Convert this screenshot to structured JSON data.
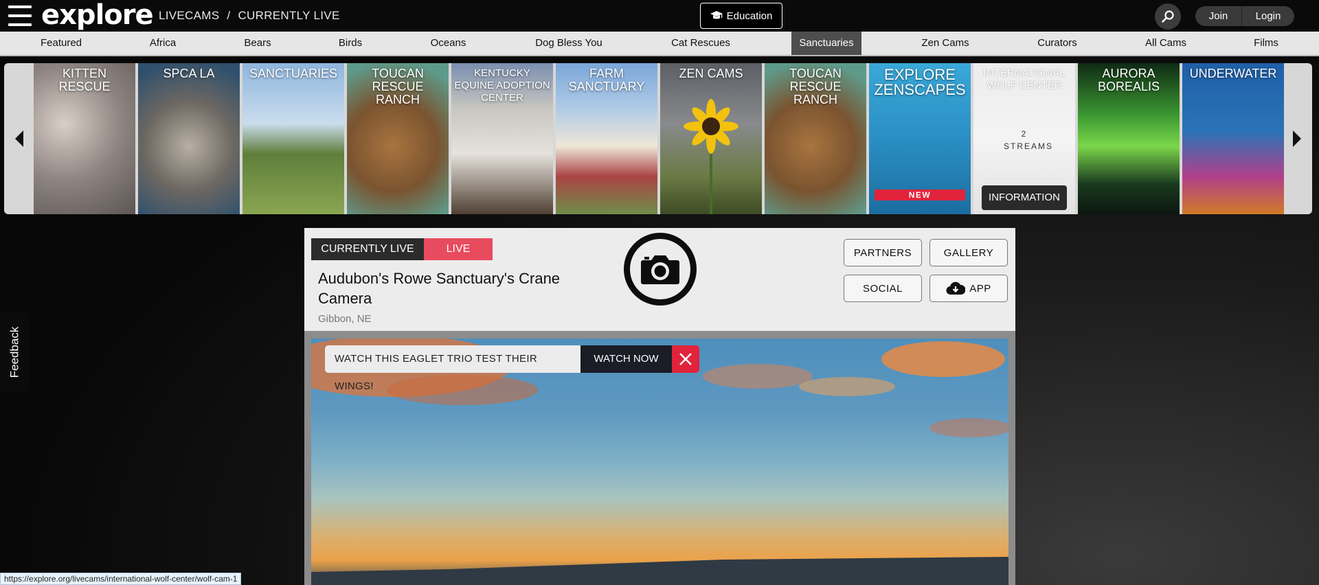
{
  "header": {
    "logo_text": "explore",
    "breadcrumb": [
      "LIVECAMS",
      "CURRENTLY LIVE"
    ],
    "breadcrumb_sep": "/",
    "education_label": "Education",
    "join_label": "Join",
    "login_label": "Login"
  },
  "nav": {
    "items": [
      "Featured",
      "Africa",
      "Bears",
      "Birds",
      "Oceans",
      "Dog Bless You",
      "Cat Rescues",
      "Sanctuaries",
      "Zen Cams",
      "Curators",
      "All Cams",
      "Films"
    ],
    "active": "Sanctuaries"
  },
  "carousel": {
    "tiles": [
      {
        "title": "KITTEN RESCUE"
      },
      {
        "title": "SPCA LA"
      },
      {
        "title": "SANCTUARIES"
      },
      {
        "title": "TOUCAN RESCUE RANCH"
      },
      {
        "title": "KENTUCKY EQUINE ADOPTION CENTER"
      },
      {
        "title": "FARM SANCTUARY"
      },
      {
        "title": "ZEN CAMS"
      },
      {
        "title": "TOUCAN RESCUE RANCH"
      },
      {
        "title": "EXPLORE ZENSCAPES",
        "badge": "NEW"
      },
      {
        "title": "INTERNATIONAL WOLF CENTER",
        "streams": "2 STREAMS",
        "button": "INFORMATION"
      },
      {
        "title": "AURORA BOREALIS"
      },
      {
        "title": "UNDERWATER"
      }
    ]
  },
  "cam": {
    "label_currently": "CURRENTLY LIVE",
    "label_live": "LIVE",
    "title": "Audubon's Rowe Sanctuary's Crane Camera",
    "location": "Gibbon, NE",
    "buttons": {
      "partners": "PARTNERS",
      "gallery": "GALLERY",
      "social": "SOCIAL",
      "app": "APP"
    }
  },
  "promo": {
    "text": "WATCH THIS EAGLET TRIO TEST THEIR WINGS!",
    "cta": "WATCH NOW"
  },
  "feedback_label": "Feedback",
  "status_url": "https://explore.org/livecams/international-wolf-center/wolf-cam-1",
  "colors": {
    "live_red": "#e84b5e",
    "new_badge": "#e1233c",
    "nav_active": "#4e4e4e"
  }
}
